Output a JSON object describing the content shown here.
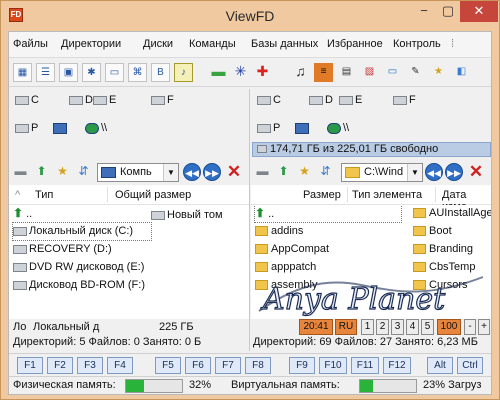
{
  "window": {
    "title": "ViewFD",
    "app_icon": "FD",
    "controls": [
      "−",
      "▢",
      "✕"
    ]
  },
  "menu": [
    "Файлы",
    "Директории",
    "Диски",
    "Команды",
    "Базы данных",
    "Избранное",
    "Контроль"
  ],
  "drives": {
    "row1_left": [
      "C",
      "D",
      "E",
      "F"
    ],
    "row2_left": [
      "P",
      "\\\\"
    ],
    "row1_right": [
      "C",
      "D",
      "E",
      "F"
    ],
    "row2_right": [
      "P",
      "\\\\"
    ]
  },
  "right_free": "174,71 ГБ из 225,01 ГБ свободно",
  "left_panel": {
    "combo": "Компь",
    "columns": [
      "Тип",
      "Общий размер"
    ],
    "up": "..",
    "items": [
      {
        "name": "Локальный диск (C:)"
      },
      {
        "name": "RECOVERY (D:)"
      },
      {
        "name": "DVD RW дисковод (E:)"
      },
      {
        "name": "Дисковод BD-ROM (F:)"
      }
    ],
    "side_item": "Новый том",
    "status_type": "Ло",
    "status_name": "Локальный д",
    "status_size": "225 ГБ",
    "counts": "Директорий: 5  Файлов: 0  Занято: 0 Б"
  },
  "right_panel": {
    "combo": "C:\\Wind",
    "columns": [
      "Размер",
      "Тип элемента",
      "Дата изме"
    ],
    "up": "..",
    "col1": [
      "addins",
      "AppCompat",
      "apppatch",
      "assembly"
    ],
    "col2": [
      "AUInstallAgen",
      "Boot",
      "Branding",
      "CbsTemp",
      "Cursors"
    ],
    "counts": "Директорий: 69  Файлов: 27  Занято: 6,23 МБ"
  },
  "time_boxes": [
    "20:41",
    "RU",
    "1",
    "2",
    "3",
    "4",
    "5",
    "100",
    "-",
    "+"
  ],
  "fkeys": [
    "F1",
    "F2",
    "F3",
    "F4",
    "F5",
    "F6",
    "F7",
    "F8",
    "F9",
    "F10",
    "F11",
    "F12",
    "Alt",
    "Ctrl"
  ],
  "memory": {
    "phys_label": "Физическая память:",
    "phys_value": "32%",
    "phys_fraction": 0.32,
    "virt_label": "Виртуальная память:",
    "virt_value": "23% Загруз",
    "virt_fraction": 0.23
  },
  "watermark": "Anya Planet",
  "colors": {
    "title_bg": "#f0c9a0",
    "panel_bg": "#f0f0f0",
    "selection": "#b9cce4",
    "mem_fill": "#29b33a",
    "orange": "#e8853d"
  }
}
